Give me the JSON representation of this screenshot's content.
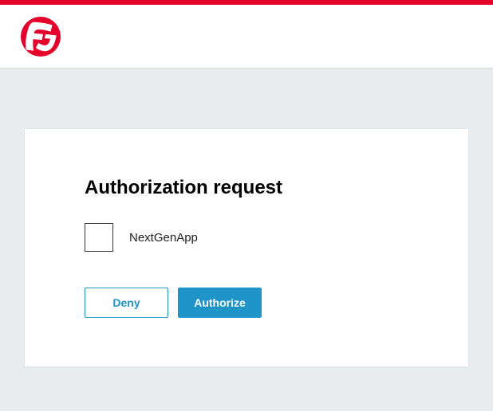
{
  "brand": {
    "logo_name": "f5-logo"
  },
  "card": {
    "title": "Authorization request",
    "app_name": "NextGenApp",
    "deny_label": "Deny",
    "authorize_label": "Authorize"
  },
  "colors": {
    "accent_red": "#e4002b",
    "primary_blue": "#1e94c8"
  }
}
